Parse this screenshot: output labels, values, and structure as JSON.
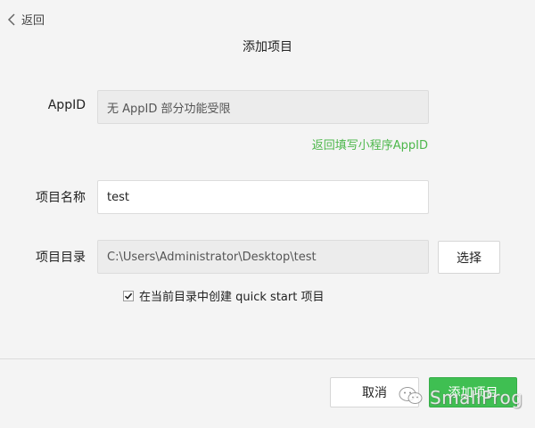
{
  "header": {
    "back_label": "返回",
    "title": "添加项目"
  },
  "form": {
    "appid": {
      "label": "AppID",
      "value": "无 AppID 部分功能受限"
    },
    "return_link": "返回填写小程序AppID",
    "project_name": {
      "label": "项目名称",
      "value": "test"
    },
    "project_dir": {
      "label": "项目目录",
      "value": "C:\\Users\\Administrator\\Desktop\\test",
      "choose_label": "选择"
    },
    "quickstart": {
      "label": "在当前目录中创建 quick start 项目",
      "checked": true
    }
  },
  "footer": {
    "cancel_label": "取消",
    "add_label": "添加项目"
  },
  "watermark": {
    "text": "SmallProg",
    "icon": "wechat-icon"
  },
  "colors": {
    "accent_green": "#3fbf52",
    "link_green": "#4db74b",
    "background": "#f4f4f4"
  }
}
